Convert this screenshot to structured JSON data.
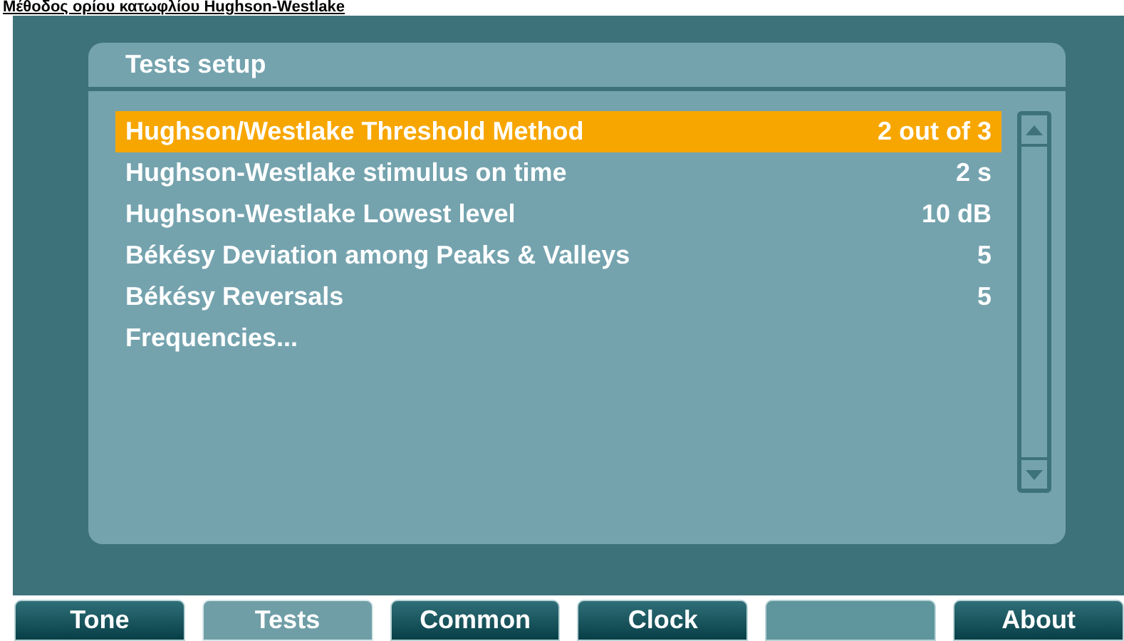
{
  "page_heading": "Μέθοδος ορίου κατωφλίου Hughson-Westlake",
  "panel": {
    "title": "Tests setup",
    "items": [
      {
        "label": "Hughson/Westlake Threshold Method",
        "value": "2 out of 3",
        "selected": true
      },
      {
        "label": "Hughson-Westlake stimulus on time",
        "value": "2 s",
        "selected": false
      },
      {
        "label": "Hughson-Westlake Lowest level",
        "value": "10 dB",
        "selected": false
      },
      {
        "label": "Békésy Deviation among Peaks & Valleys",
        "value": "5",
        "selected": false
      },
      {
        "label": "Békésy Reversals",
        "value": "5",
        "selected": false
      },
      {
        "label": "Frequencies...",
        "selected": false
      }
    ]
  },
  "tabs": [
    {
      "label": "Tone",
      "selected": false,
      "disabled": false
    },
    {
      "label": "Tests",
      "selected": true,
      "disabled": false
    },
    {
      "label": "Common",
      "selected": false,
      "disabled": false
    },
    {
      "label": "Clock",
      "selected": false,
      "disabled": false
    },
    {
      "selected": false,
      "disabled": true
    },
    {
      "label": "About",
      "selected": false,
      "disabled": false
    }
  ]
}
